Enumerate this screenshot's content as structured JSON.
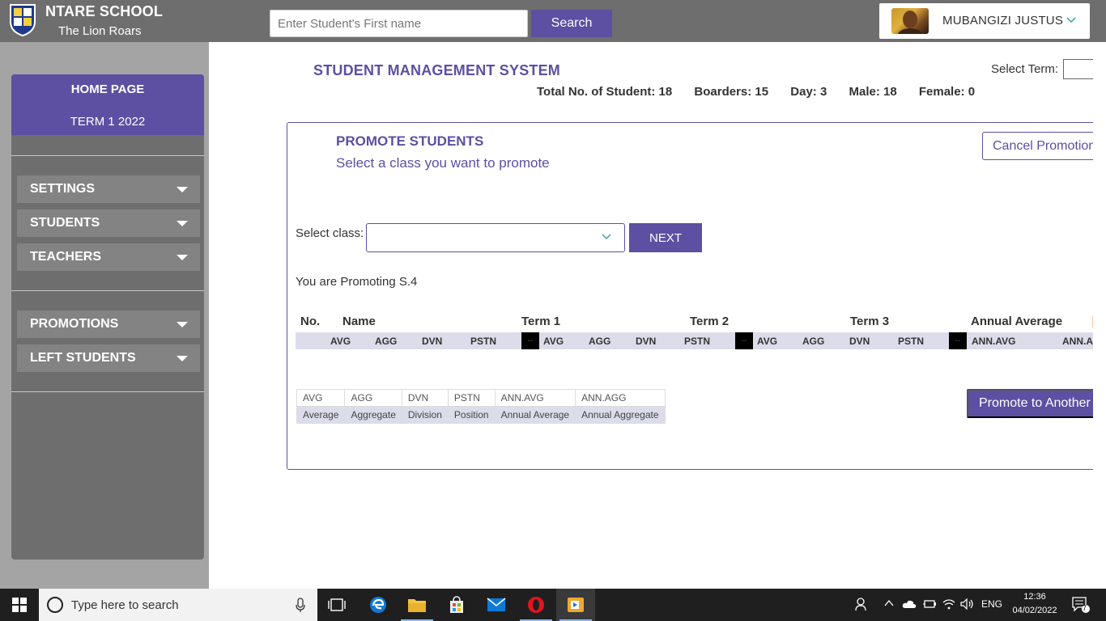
{
  "header": {
    "school_name": "NTARE SCHOOL",
    "motto": "The Lion Roars",
    "search": {
      "placeholder": "Enter Student's First name",
      "value": "",
      "button_label": "Search"
    },
    "user": {
      "name": "MUBANGIZI JUSTUS"
    }
  },
  "sidebar": {
    "home_label": "HOME PAGE",
    "term_label": "TERM 1 2022",
    "groups": [
      [
        "SETTINGS",
        "STUDENTS",
        "TEACHERS"
      ],
      [
        "PROMOTIONS",
        "LEFT STUDENTS"
      ]
    ]
  },
  "main": {
    "title": "STUDENT MANAGEMENT SYSTEM",
    "select_term_label": "Select Term:",
    "stats": {
      "total": "Total No. of Student: 18",
      "boarders": "Boarders: 15",
      "day": "Day: 3",
      "male": "Male: 18",
      "female": "Female: 0"
    }
  },
  "promote": {
    "title": "PROMOTE STUDENTS",
    "subtitle": "Select a class you want to promote",
    "cancel_label": "Cancel Promotion",
    "select_class_label": "Select class:",
    "select_class_value": "",
    "next_label": "NEXT",
    "promoting_text": "You are Promoting S.4",
    "table": {
      "top_headers": [
        "No.",
        "Name",
        "Term 1",
        "Term 2",
        "Term 3",
        "Annual Average"
      ],
      "sub_headers": [
        "AVG",
        "AGG",
        "DVN",
        "PSTN",
        "--",
        "AVG",
        "AGG",
        "DVN",
        "PSTN",
        "--",
        "AVG",
        "AGG",
        "DVN",
        "PSTN",
        "--",
        "ANN.AVG",
        "ANN.AGG"
      ]
    },
    "legend": {
      "abbr": [
        "AVG",
        "AGG",
        "DVN",
        "PSTN",
        "ANN.AVG",
        "ANN.AGG"
      ],
      "desc": [
        "Average",
        "Aggregate",
        "Division",
        "Position",
        "Annual Average",
        "Annual Aggregate"
      ]
    },
    "promote_another_label": "Promote to Another Class"
  },
  "taskbar": {
    "search_placeholder": "Type here to search",
    "tray": {
      "language": "ENG",
      "notification_count": "7"
    },
    "clock": {
      "time": "12:36",
      "date": "04/02/2022"
    }
  },
  "colors": {
    "accent": "#5d4fa2",
    "topbar": "#6e6e6e",
    "sidebar": "#6e6e6e",
    "nav_item": "#838383"
  }
}
